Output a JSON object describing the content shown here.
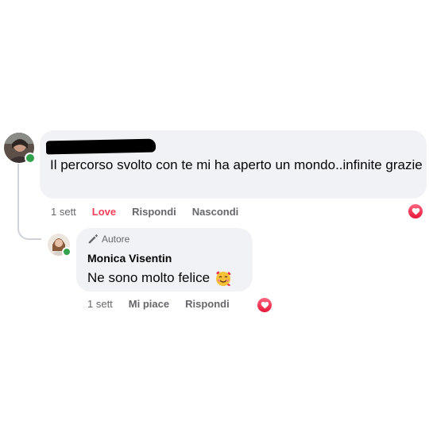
{
  "comment1": {
    "text": "Il percorso svolto con te mi ha aperto un mondo..infinite grazie",
    "time": "1 sett",
    "reaction_label": "Love",
    "reply_label": "Rispondi",
    "hide_label": "Nascondi",
    "reaction_icon": "heart-icon"
  },
  "comment2": {
    "badge": "Autore",
    "author": "Monica Visentin",
    "text": "Ne sono molto felice",
    "emoji": "smiling-face-with-hearts",
    "time": "1 sett",
    "like_label": "Mi piace",
    "reply_label": "Rispondi",
    "reaction_icon": "heart-icon"
  },
  "colors": {
    "bubble": "#f0f2f5",
    "love": "#f33e58",
    "online": "#31a24c",
    "muted": "#65676b"
  }
}
